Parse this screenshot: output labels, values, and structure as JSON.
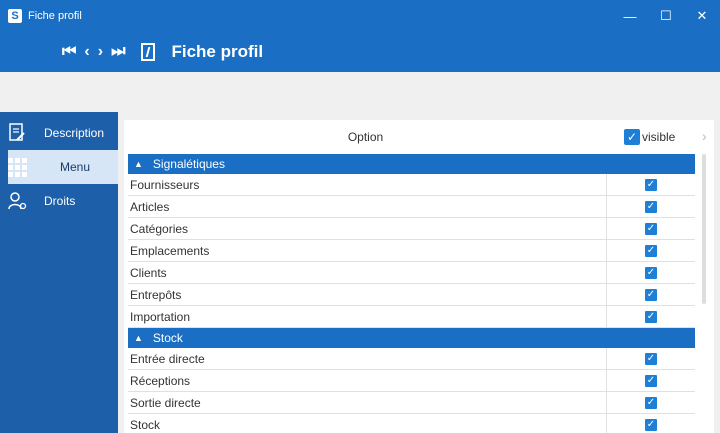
{
  "window": {
    "title": "Fiche profil",
    "logo_letter": "S",
    "minimize": "—",
    "maximize": "☐",
    "close": "✕"
  },
  "header": {
    "title": "Fiche profil",
    "nav": {
      "first": "⏮",
      "prev": "‹",
      "next": "›",
      "last": "⏭"
    }
  },
  "sidebar": {
    "items": [
      {
        "label": "Description",
        "icon": "description-icon"
      },
      {
        "label": "Menu",
        "icon": "grid-icon"
      },
      {
        "label": "Droits",
        "icon": "user-rights-icon"
      }
    ]
  },
  "table": {
    "col_option": "Option",
    "col_visible": "visible",
    "groups": [
      {
        "label": "Signalétiques",
        "rows": [
          "Fournisseurs",
          "Articles",
          "Catégories",
          "Emplacements",
          "Clients",
          "Entrepôts",
          "Importation"
        ]
      },
      {
        "label": "Stock",
        "rows": [
          "Entrée directe",
          "Réceptions",
          "Sortie directe",
          "Stock"
        ]
      }
    ]
  },
  "colors": {
    "accent": "#1a6fc4",
    "sidebar": "#1d5fa8",
    "checkbox": "#1e7fd6"
  }
}
